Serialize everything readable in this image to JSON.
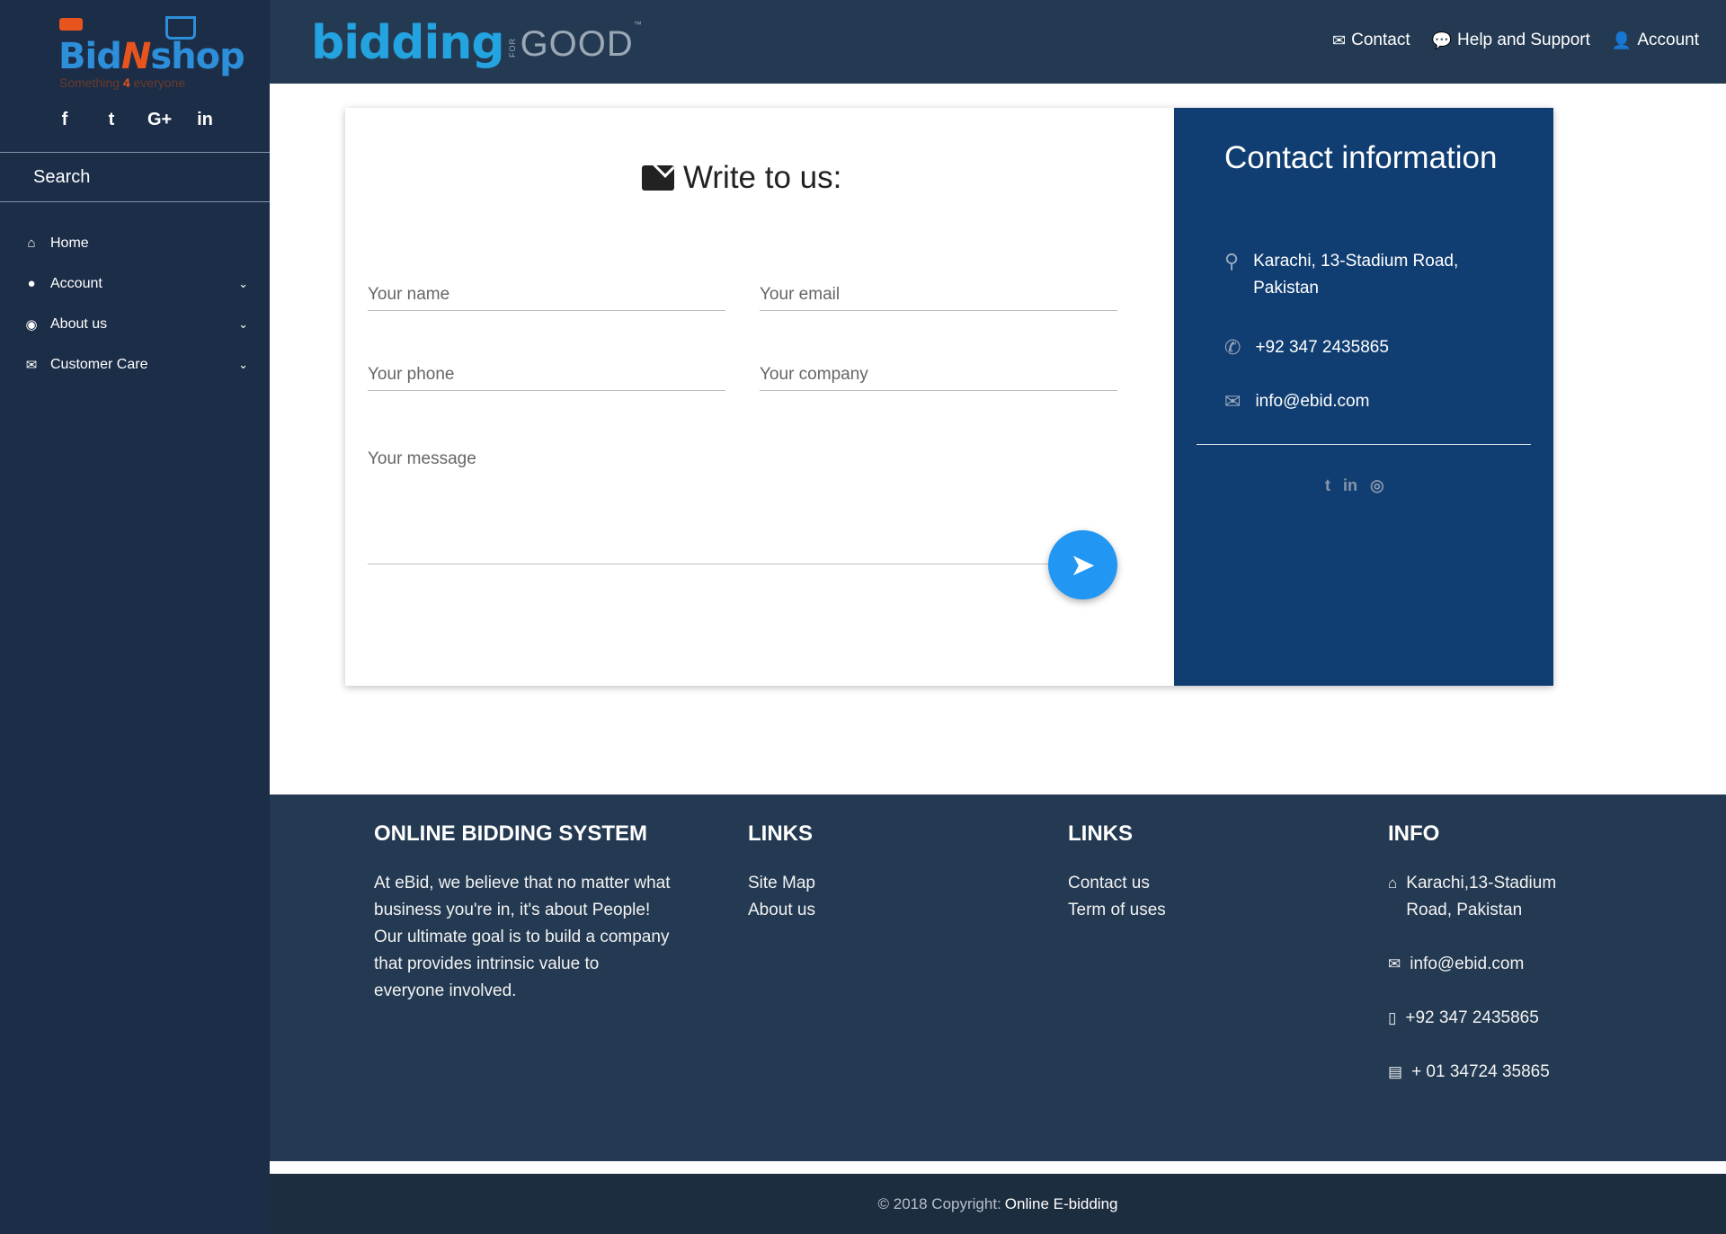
{
  "sidebar": {
    "logo": {
      "bid": "Bid",
      "n": "N",
      "shop": "shop",
      "tag_left": "Something ",
      "tag_four": "4",
      "tag_right": " everyone"
    },
    "social": [
      "f",
      "t",
      "G+",
      "in"
    ],
    "search_label": "Search",
    "menu": [
      {
        "label": "Home",
        "icon": "home-icon",
        "glyph": "⌂",
        "has_submenu": false
      },
      {
        "label": "Account",
        "icon": "user-icon",
        "glyph": "●",
        "has_submenu": true
      },
      {
        "label": "About us",
        "icon": "eye-icon",
        "glyph": "◉",
        "has_submenu": true
      },
      {
        "label": "Customer Care",
        "icon": "envelope-icon",
        "glyph": "✉",
        "has_submenu": true
      }
    ]
  },
  "header": {
    "brand_main": "bidding",
    "brand_for": "FOR",
    "brand_good": "GOOD",
    "brand_tm": "™",
    "nav": [
      {
        "label": "Contact",
        "icon": "envelope-icon",
        "glyph": "✉"
      },
      {
        "label": "Help and Support",
        "icon": "comments-icon",
        "glyph": "💬"
      },
      {
        "label": "Account",
        "icon": "user-icon",
        "glyph": "👤"
      }
    ]
  },
  "form": {
    "title": "Write to us:",
    "name_placeholder": "Your name",
    "email_placeholder": "Your email",
    "phone_placeholder": "Your phone",
    "company_placeholder": "Your company",
    "message_placeholder": "Your message",
    "send_glyph": "➤"
  },
  "contact_info": {
    "title": "Contact information",
    "address": "Karachi, 13-Stadium Road, Pakistan",
    "phone": "+92 347 2435865",
    "email": "info@ebid.com",
    "social": [
      "t",
      "in",
      "◎"
    ]
  },
  "footer": {
    "about": {
      "heading": "ONLINE BIDDING SYSTEM",
      "text": "At eBid, we believe that no matter what business you're in, it's about People! Our ultimate goal is to build a company that provides intrinsic value to everyone involved."
    },
    "links1": {
      "heading": "LINKS",
      "items": [
        "Site Map",
        "About us"
      ]
    },
    "links2": {
      "heading": "LINKS",
      "items": [
        "Contact us",
        "Term of uses"
      ]
    },
    "info": {
      "heading": "INFO",
      "address": "Karachi,13-Stadium Road, Pakistan",
      "email": "info@ebid.com",
      "phone": "+92 347 2435865",
      "fax": "+ 01 34724 35865"
    },
    "copyright_prefix": "© 2018 Copyright:",
    "copyright_link": "Online E-bidding"
  },
  "colors": {
    "sidebar": "#1c2d48",
    "header": "#243a52",
    "info_panel": "#113e72",
    "accent": "#2196f3"
  }
}
